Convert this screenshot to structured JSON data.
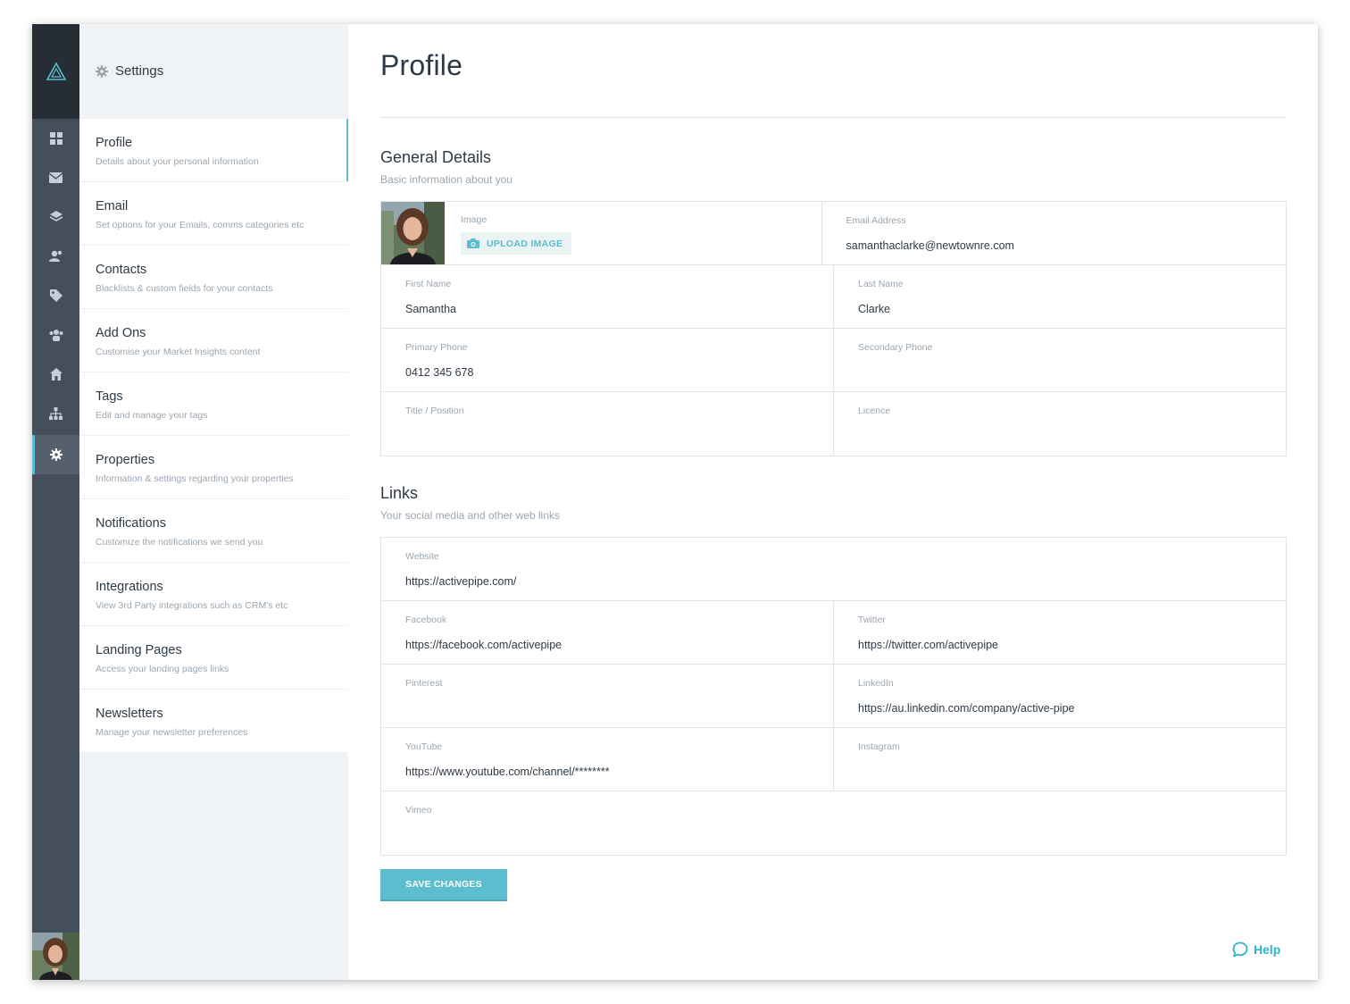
{
  "rail": {
    "items": [
      "dashboard-icon",
      "mail-icon",
      "layers-icon",
      "contacts-icon",
      "tag-icon",
      "team-icon",
      "home-icon",
      "sitemap-icon",
      "gear-icon"
    ],
    "active": "gear-icon"
  },
  "settings": {
    "title": "Settings",
    "items": [
      {
        "label": "Profile",
        "desc": "Details about your personal information"
      },
      {
        "label": "Email",
        "desc": "Set options for your Emails, comms categories etc"
      },
      {
        "label": "Contacts",
        "desc": "Blacklists & custom fields for your contacts"
      },
      {
        "label": "Add Ons",
        "desc": "Customise your Market Insights content"
      },
      {
        "label": "Tags",
        "desc": "Edit and manage your tags"
      },
      {
        "label": "Properties",
        "desc": "Information & settings regarding your properties"
      },
      {
        "label": "Notifications",
        "desc": "Customize the notifications we send you"
      },
      {
        "label": "Integrations",
        "desc": "View 3rd Party integrations such as CRM's etc"
      },
      {
        "label": "Landing Pages",
        "desc": "Access your landing pages links"
      },
      {
        "label": "Newsletters",
        "desc": "Manage your newsletter preferences"
      }
    ]
  },
  "page": {
    "title": "Profile",
    "general": {
      "title": "General Details",
      "subtitle": "Basic information about you",
      "image_label": "Image",
      "upload_label": "UPLOAD IMAGE",
      "email": {
        "label": "Email Address",
        "value": "samanthaclarke@newtownre.com"
      },
      "first_name": {
        "label": "First Name",
        "value": "Samantha"
      },
      "last_name": {
        "label": "Last Name",
        "value": "Clarke"
      },
      "primary_phone": {
        "label": "Primary Phone",
        "value": "0412 345 678"
      },
      "secondary_phone": {
        "label": "Secondary Phone",
        "value": ""
      },
      "title_position": {
        "label": "Title / Position",
        "value": ""
      },
      "licence": {
        "label": "Licence",
        "value": ""
      }
    },
    "links": {
      "title": "Links",
      "subtitle": "Your social media and other web links",
      "website": {
        "label": "Website",
        "value": "https://activepipe.com/"
      },
      "facebook": {
        "label": "Facebook",
        "value": "https://facebook.com/activepipe"
      },
      "twitter": {
        "label": "Twitter",
        "value": "https://twitter.com/activepipe"
      },
      "pinterest": {
        "label": "Pinterest",
        "value": ""
      },
      "linkedin": {
        "label": "LinkedIn",
        "value": "https://au.linkedin.com/company/active-pipe"
      },
      "youtube": {
        "label": "YouTube",
        "value": "https://www.youtube.com/channel/********"
      },
      "instagram": {
        "label": "Instagram",
        "value": ""
      },
      "vimeo": {
        "label": "Vimeo",
        "value": ""
      }
    },
    "save_label": "SAVE CHANGES",
    "help_label": "Help"
  },
  "colors": {
    "accent": "#5bbdcd",
    "rail": "#454f5b",
    "rail_top": "#262d35",
    "panel": "#f0f3f5"
  }
}
